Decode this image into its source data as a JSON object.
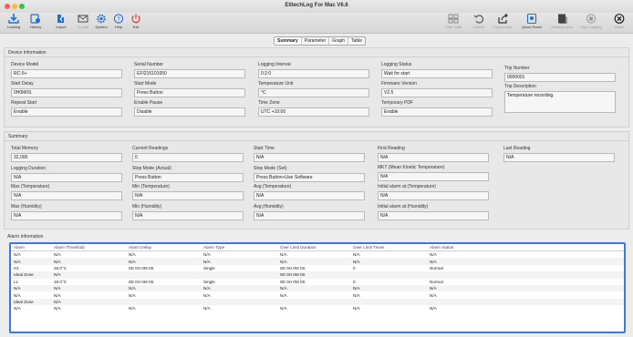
{
  "window": {
    "title": "ElitechLog For Mac V6.6"
  },
  "toolbar": {
    "left": [
      {
        "label": "Loading",
        "icon": "download-icon"
      },
      {
        "label": "History",
        "icon": "history-icon"
      },
      {
        "label": "Import",
        "icon": "import-icon"
      },
      {
        "label": "E-mail",
        "icon": "email-icon"
      },
      {
        "label": "System",
        "icon": "gear-icon"
      },
      {
        "label": "Help",
        "icon": "help-icon"
      },
      {
        "label": "Exit",
        "icon": "power-icon"
      }
    ],
    "right": [
      {
        "label": "Filter Data",
        "icon": "grid-icon"
      },
      {
        "label": "Cancel",
        "icon": "undo-icon"
      },
      {
        "label": "Export Data",
        "icon": "export-icon"
      },
      {
        "label": "Quick Reset",
        "icon": "reset-icon"
      },
      {
        "label": "Shadow Area",
        "icon": "shadow-icon"
      },
      {
        "label": "Stop Logging",
        "icon": "stop-icon"
      },
      {
        "label": "Close",
        "icon": "close-icon"
      }
    ]
  },
  "tabs": [
    "Summary",
    "Parameter",
    "Graph",
    "Table"
  ],
  "device_info": {
    "title": "Device Information",
    "fields": [
      {
        "label": "Device Model",
        "value": "RC-5+"
      },
      {
        "label": "Serial Number",
        "value": "EFI216101650"
      },
      {
        "label": "Logging Interval",
        "value": "0:2:0"
      },
      {
        "label": "Logging Status",
        "value": "Wait for start"
      },
      {
        "label": "Start Delay",
        "value": "0H0M0S"
      },
      {
        "label": "Start Mode",
        "value": "Press Button"
      },
      {
        "label": "Temperature Unit",
        "value": "°C"
      },
      {
        "label": "Firmware Version",
        "value": "V2.5"
      },
      {
        "label": "Repeat Start",
        "value": "Enable"
      },
      {
        "label": "Enable Pause",
        "value": "Disable"
      },
      {
        "label": "Time Zone",
        "value": "UTC +10:00"
      },
      {
        "label": "Temporary PDF",
        "value": "Enable"
      }
    ],
    "trip_number": {
      "label": "Trip Number",
      "value": "0000001"
    },
    "trip_description": {
      "label": "Trip Description",
      "value": "Temperature recording."
    }
  },
  "summary": {
    "title": "Summary",
    "fields": [
      {
        "label": "Total Memory",
        "value": "32,000"
      },
      {
        "label": "Current Readings",
        "value": "0"
      },
      {
        "label": "Start Time",
        "value": "N/A"
      },
      {
        "label": "First Reading",
        "value": "N/A"
      },
      {
        "label": "Last Reading",
        "value": "N/A"
      },
      {
        "label": "Logging Duration",
        "value": "N/A"
      },
      {
        "label": "Stop Mode (Actual)",
        "value": "Press Button"
      },
      {
        "label": "Stop Mode (Set)",
        "value": "Press Button+Use Software"
      },
      {
        "label": "MKT (Mean Kinetic Temperature)",
        "value": "N/A"
      },
      {
        "label": "Max (Temperature)",
        "value": "N/A"
      },
      {
        "label": "Min (Temperature)",
        "value": "N/A"
      },
      {
        "label": "Avg (Temperature)",
        "value": "N/A"
      },
      {
        "label": "Initial alarm at (Temperature)",
        "value": "N/A"
      },
      {
        "label": "Max (Humidity)",
        "value": "N/A"
      },
      {
        "label": "Min (Humidity)",
        "value": "N/A"
      },
      {
        "label": "Avg (Humidity)",
        "value": "N/A"
      },
      {
        "label": "Initial alarm at (Humidity)",
        "value": "N/A"
      }
    ]
  },
  "alarm": {
    "title": "Alarm Information",
    "columns": [
      "Alarm",
      "Alarm Threshold",
      "Alarm Delay",
      "Alarm Type",
      "Over Limit Duration",
      "Over Limit Times",
      "Alarm Status"
    ],
    "rows": [
      [
        "N/A",
        "N/A",
        "N/A",
        "N/A",
        "N/A",
        "N/A",
        "N/A"
      ],
      [
        "N/A",
        "N/A",
        "N/A",
        "N/A",
        "N/A",
        "N/A",
        "N/A"
      ],
      [
        "H1",
        "25.0°C",
        "0D 0H 0M 0S",
        "Single",
        "0D 0H 0M 0S",
        "0",
        "Normal"
      ],
      [
        "Ideal Zone",
        "N/A",
        "",
        "",
        "0D 0H 0M 0S",
        "",
        ""
      ],
      [
        "L1",
        "18.0°C",
        "0D 0H 0M 0S",
        "Single",
        "0D 0H 0M 0S",
        "0",
        "Normal"
      ],
      [
        "N/A",
        "N/A",
        "N/A",
        "N/A",
        "N/A",
        "N/A",
        "N/A"
      ],
      [
        "N/A",
        "N/A",
        "N/A",
        "N/A",
        "N/A",
        "N/A",
        "N/A"
      ],
      [
        "Ideal Zone",
        "N/A",
        "",
        "",
        "",
        "",
        ""
      ],
      [
        "N/A",
        "N/A",
        "N/A",
        "N/A",
        "N/A",
        "N/A",
        "N/A"
      ]
    ]
  },
  "colors": {
    "accent": "#1f6fd6",
    "exit_red": "#e0372d",
    "selection": "#3a7ae0"
  }
}
